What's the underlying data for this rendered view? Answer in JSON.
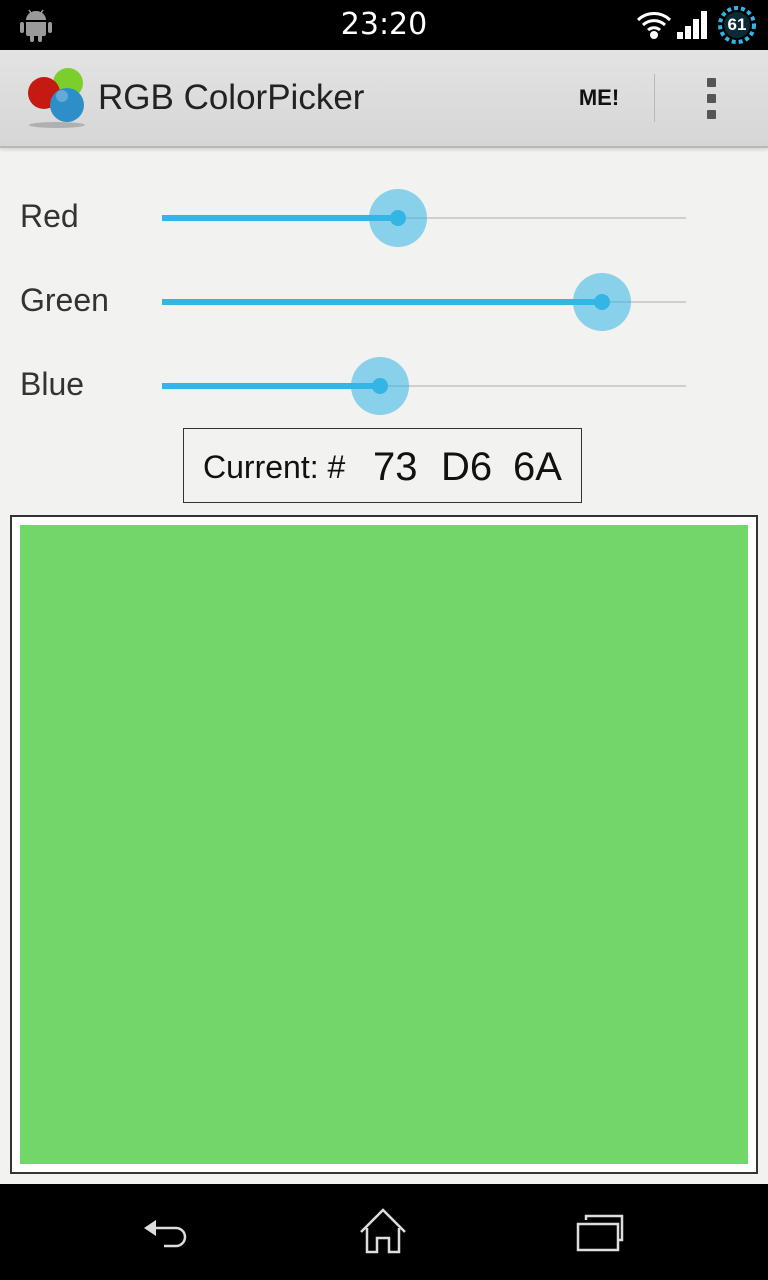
{
  "status_bar": {
    "time": "23:20",
    "battery_level": "61",
    "icons": [
      "android-icon",
      "wifi-icon",
      "signal-icon",
      "battery-icon"
    ]
  },
  "action_bar": {
    "title": "RGB ColorPicker",
    "me_label": "ME!",
    "icons": [
      "app-logo-icon",
      "overflow-menu-icon"
    ]
  },
  "sliders": [
    {
      "label": "Red",
      "value": 115,
      "max": 255
    },
    {
      "label": "Green",
      "value": 214,
      "max": 255
    },
    {
      "label": "Blue",
      "value": 106,
      "max": 255
    }
  ],
  "current": {
    "prefix": "Current: #",
    "r_hex": "73",
    "g_hex": "D6",
    "b_hex": "6A"
  },
  "preview": {
    "color": "#73D66A"
  },
  "colors": {
    "accent": "#33b5e5",
    "status_bar": "#000000",
    "action_bar": "#dcdcdc"
  },
  "nav_bar": {
    "icons": [
      "back-icon",
      "home-icon",
      "recent-apps-icon"
    ]
  }
}
